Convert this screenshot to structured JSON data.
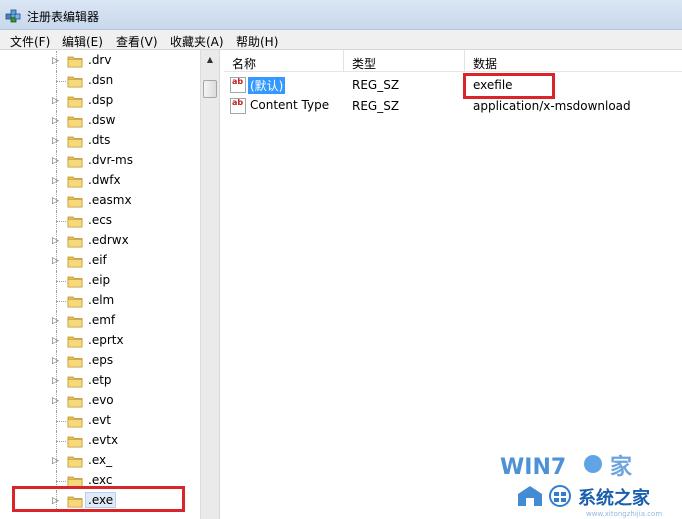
{
  "window": {
    "title": "注册表编辑器",
    "icon": "regedit-icon"
  },
  "menu": [
    {
      "label": "文件(F)"
    },
    {
      "label": "编辑(E)"
    },
    {
      "label": "查看(V)"
    },
    {
      "label": "收藏夹(A)"
    },
    {
      "label": "帮助(H)"
    }
  ],
  "tree": {
    "items": [
      {
        "label": ".drv",
        "expandable": true
      },
      {
        "label": ".dsn",
        "expandable": false
      },
      {
        "label": ".dsp",
        "expandable": true
      },
      {
        "label": ".dsw",
        "expandable": true
      },
      {
        "label": ".dts",
        "expandable": true
      },
      {
        "label": ".dvr-ms",
        "expandable": true
      },
      {
        "label": ".dwfx",
        "expandable": true
      },
      {
        "label": ".easmx",
        "expandable": true
      },
      {
        "label": ".ecs",
        "expandable": false
      },
      {
        "label": ".edrwx",
        "expandable": true
      },
      {
        "label": ".eif",
        "expandable": true
      },
      {
        "label": ".eip",
        "expandable": false
      },
      {
        "label": ".elm",
        "expandable": false
      },
      {
        "label": ".emf",
        "expandable": true
      },
      {
        "label": ".eprtx",
        "expandable": true
      },
      {
        "label": ".eps",
        "expandable": true
      },
      {
        "label": ".etp",
        "expandable": true
      },
      {
        "label": ".evo",
        "expandable": true
      },
      {
        "label": ".evt",
        "expandable": false
      },
      {
        "label": ".evtx",
        "expandable": false
      },
      {
        "label": ".ex_",
        "expandable": true
      },
      {
        "label": ".exc",
        "expandable": false
      },
      {
        "label": ".exe",
        "expandable": true,
        "selected": true
      }
    ]
  },
  "columns": {
    "name": "名称",
    "type": "类型",
    "data": "数据"
  },
  "values": [
    {
      "icon": "ab",
      "name": "(默认)",
      "type": "REG_SZ",
      "data": "exefile",
      "highlighted": true
    },
    {
      "icon": "ab",
      "name": "Content Type",
      "type": "REG_SZ",
      "data": "application/x-msdownload",
      "highlighted": false
    }
  ],
  "annotations": {
    "highlight_color": "#d9252a"
  },
  "watermark": {
    "brand": "WIN7",
    "text": "系统之家"
  }
}
